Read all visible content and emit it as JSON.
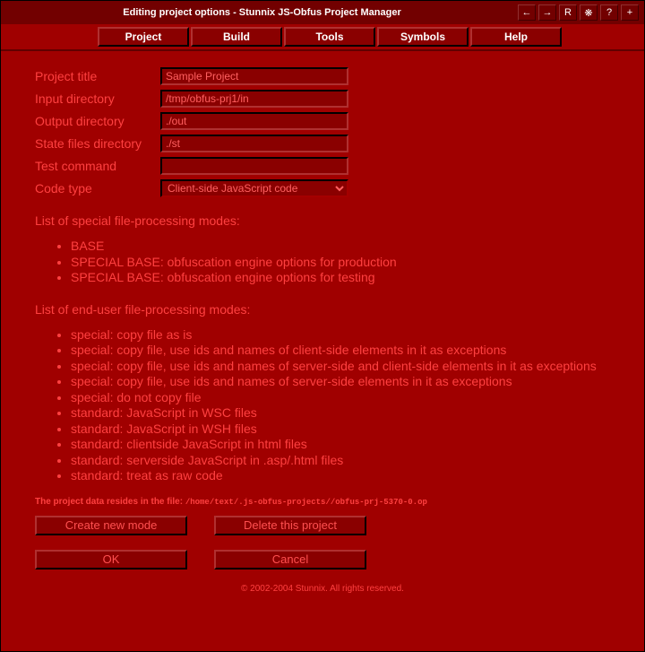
{
  "window": {
    "title": "Editing project options - Stunnix JS-Obfus Project Manager",
    "buttons": {
      "back": "←",
      "fwd": "→",
      "r": "R",
      "gear": "❋",
      "help": "?",
      "plus": "+"
    }
  },
  "menu": {
    "project": "Project",
    "build": "Build",
    "tools": "Tools",
    "symbols": "Symbols",
    "help": "Help"
  },
  "form": {
    "project_title": {
      "label": "Project title",
      "value": "Sample Project"
    },
    "input_dir": {
      "label": "Input directory",
      "value": "/tmp/obfus-prj1/in"
    },
    "output_dir": {
      "label": "Output directory",
      "value": "./out"
    },
    "state_dir": {
      "label": "State files directory",
      "value": "./st"
    },
    "test_cmd": {
      "label": "Test command",
      "value": ""
    },
    "code_type": {
      "label": "Code type",
      "value": "Client-side JavaScript code"
    }
  },
  "section1": {
    "heading": "List of special file-processing modes:",
    "items": [
      "BASE",
      "SPECIAL BASE: obfuscation engine options for production",
      "SPECIAL BASE: obfuscation engine options for testing"
    ]
  },
  "section2": {
    "heading": "List of end-user file-processing modes:",
    "items": [
      "special: copy file as is",
      "special: copy file, use ids and names of client-side elements in it as exceptions",
      "special: copy file, use ids and names of server-side and client-side elements in it as exceptions",
      "special: copy file, use ids and names of server-side elements in it as exceptions",
      "special: do not copy file",
      "standard: JavaScript in WSC files",
      "standard: JavaScript in WSH files",
      "standard: clientside JavaScript in html files",
      "standard: serverside JavaScript in .asp/.html files",
      "standard: treat as raw code"
    ]
  },
  "file_row": {
    "prefix": "The project data resides in the file: ",
    "path": "/home/text/.js-obfus-projects//obfus-prj-5370-0.op"
  },
  "buttons": {
    "create_mode": "Create new mode",
    "delete_project": "Delete this project",
    "ok": "OK",
    "cancel": "Cancel"
  },
  "footer": "© 2002-2004 Stunnix. All rights reserved."
}
